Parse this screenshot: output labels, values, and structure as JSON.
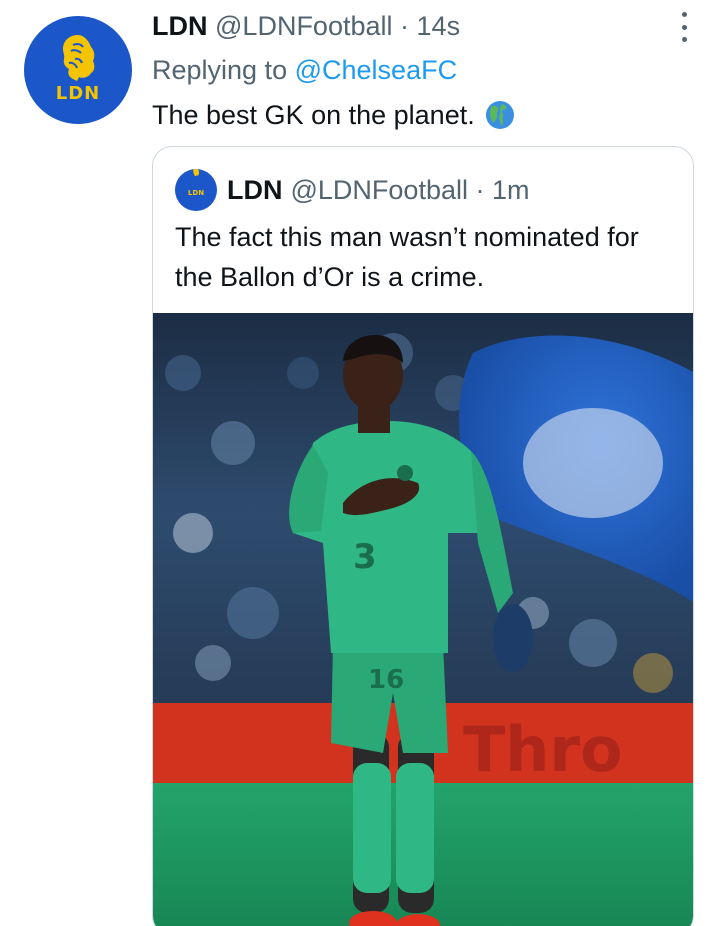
{
  "tweet": {
    "author_name": "LDN",
    "author_handle": "@LDNFootball",
    "separator": "·",
    "time": "14s",
    "replying_prefix": "Replying to",
    "replying_to": "@ChelseaFC",
    "text": "The best GK on the planet.",
    "emoji": "globe-americas",
    "avatar_text": "LDN"
  },
  "quoted": {
    "author_name": "LDN",
    "author_handle": "@LDNFootball",
    "separator": "·",
    "time": "1m",
    "text": "The fact this man wasn’t nominated for the Ballon d’Or is a crime.",
    "avatar_text": "LDN",
    "photo": {
      "shirt_number": "16",
      "banner_text": "Thro",
      "kit_color": "#2fb885",
      "flag_color": "#1a5bc4",
      "pitch_color": "#1f9a62",
      "board_color": "#d2331f"
    }
  },
  "colors": {
    "text": "#0f1419",
    "secondary": "#536471",
    "link": "#1d9bf0",
    "brand_blue": "#1b57c9",
    "brand_yellow": "#f5c400"
  }
}
